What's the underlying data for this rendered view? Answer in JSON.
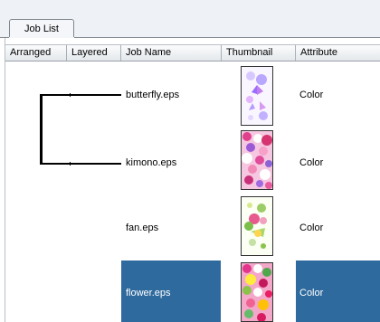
{
  "tab": {
    "label": "Job List"
  },
  "columns": [
    "Arranged",
    "Layered",
    "Job Name",
    "Thumbnail",
    "Attribute"
  ],
  "rows": [
    {
      "job_name": "butterfly.eps",
      "thumbnail_icon": "butterfly-thumbnail",
      "attribute": "Color",
      "selected": false
    },
    {
      "job_name": "kimono.eps",
      "thumbnail_icon": "kimono-thumbnail",
      "attribute": "Color",
      "selected": false
    },
    {
      "job_name": "fan.eps",
      "thumbnail_icon": "fan-thumbnail",
      "attribute": "Color",
      "selected": false
    },
    {
      "job_name": "flower.eps",
      "thumbnail_icon": "flower-thumbnail",
      "attribute": "Color",
      "selected": true
    }
  ],
  "colors": {
    "selection": "#2f6a9e",
    "tab_bg": "#eef2f6"
  }
}
